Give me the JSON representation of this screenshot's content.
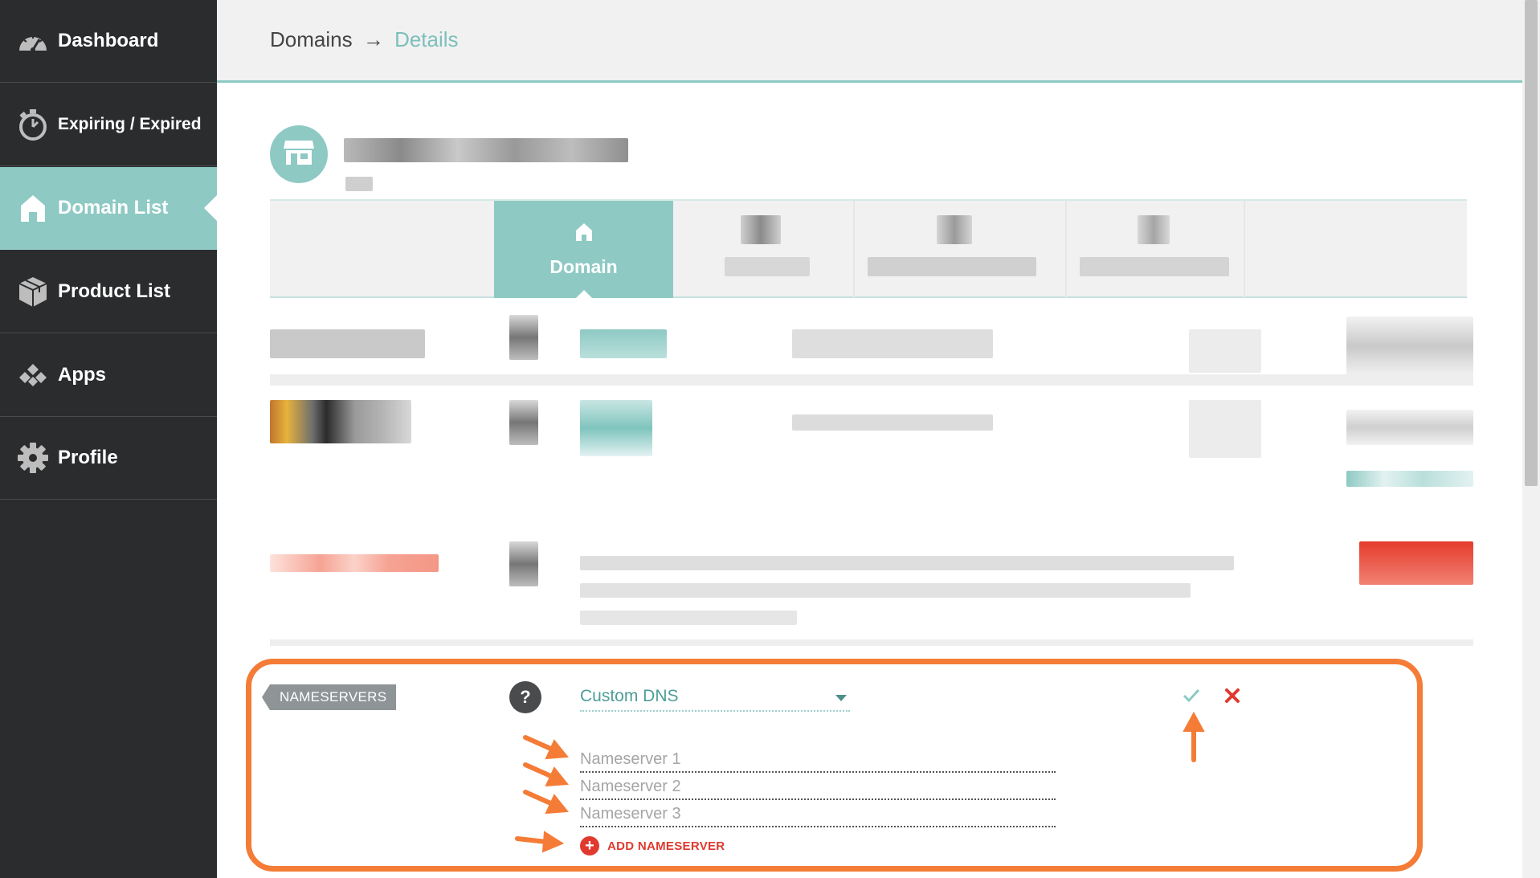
{
  "sidebar": {
    "items": [
      {
        "label": "Dashboard",
        "icon": "dashboard-icon"
      },
      {
        "label": "Expiring / Expired",
        "icon": "stopwatch-icon"
      },
      {
        "label": "Domain List",
        "icon": "home-icon",
        "active": true
      },
      {
        "label": "Product List",
        "icon": "package-icon"
      },
      {
        "label": "Apps",
        "icon": "apps-icon"
      },
      {
        "label": "Profile",
        "icon": "gear-icon"
      }
    ]
  },
  "header": {
    "breadcrumb_root": "Domains",
    "breadcrumb_arrow": "→",
    "breadcrumb_current": "Details"
  },
  "tabs": {
    "active_label": "Domain"
  },
  "nameservers": {
    "section_label": "NAMESERVERS",
    "help_symbol": "?",
    "dns_type": "Custom DNS",
    "inputs": [
      {
        "placeholder": "Nameserver 1",
        "value": ""
      },
      {
        "placeholder": "Nameserver 2",
        "value": ""
      },
      {
        "placeholder": "Nameserver 3",
        "value": ""
      }
    ],
    "add_label": "ADD NAMESERVER",
    "add_symbol": "+"
  },
  "colors": {
    "sidebar_bg": "#2b2c2e",
    "accent_teal": "#8ec9c4",
    "annotation_orange": "#f47c37",
    "danger_red": "#e03a2f"
  }
}
